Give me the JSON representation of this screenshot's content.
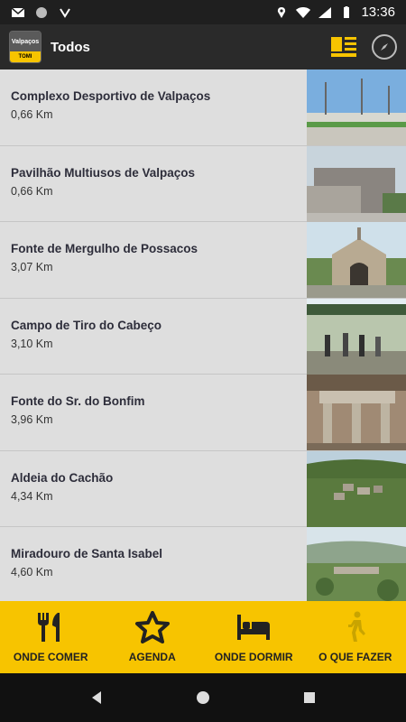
{
  "status_bar": {
    "time": "13:36",
    "icons": [
      "gmail-icon",
      "circle-icon",
      "download-icon",
      "location-icon",
      "wifi-icon",
      "signal-icon",
      "battery-icon"
    ]
  },
  "app_bar": {
    "logo_text_top": "Valpaços",
    "logo_text_bottom": "TOMI",
    "title": "Todos",
    "actions": [
      "list-view-icon",
      "compass-icon"
    ]
  },
  "places": [
    {
      "name": "Complexo Desportivo de Valpaços",
      "distance": "0,66 Km",
      "thumb": "sports-complex"
    },
    {
      "name": " Pavilhão Multiusos de Valpaços",
      "distance": "0,66 Km",
      "thumb": "pavilion"
    },
    {
      "name": "Fonte de Mergulho de Possacos",
      "distance": "3,07 Km",
      "thumb": "fountain-chapel"
    },
    {
      "name": "Campo de Tiro do Cabeço",
      "distance": "3,10 Km",
      "thumb": "shooting-range"
    },
    {
      "name": "Fonte do Sr. do Bonfim",
      "distance": "3,96 Km",
      "thumb": "stone-fountain"
    },
    {
      "name": "Aldeia do Cachão",
      "distance": "4,34 Km",
      "thumb": "village"
    },
    {
      "name": "Miradouro de Santa Isabel",
      "distance": "4,60 Km",
      "thumb": "viewpoint"
    }
  ],
  "bottom_nav": {
    "items": [
      {
        "label": "ONDE COMER",
        "icon": "food-icon"
      },
      {
        "label": "AGENDA",
        "icon": "star-icon"
      },
      {
        "label": "ONDE DORMIR",
        "icon": "bed-icon"
      },
      {
        "label": "O QUE FAZER",
        "icon": "walking-person-icon"
      }
    ],
    "background": "#f7c400"
  }
}
